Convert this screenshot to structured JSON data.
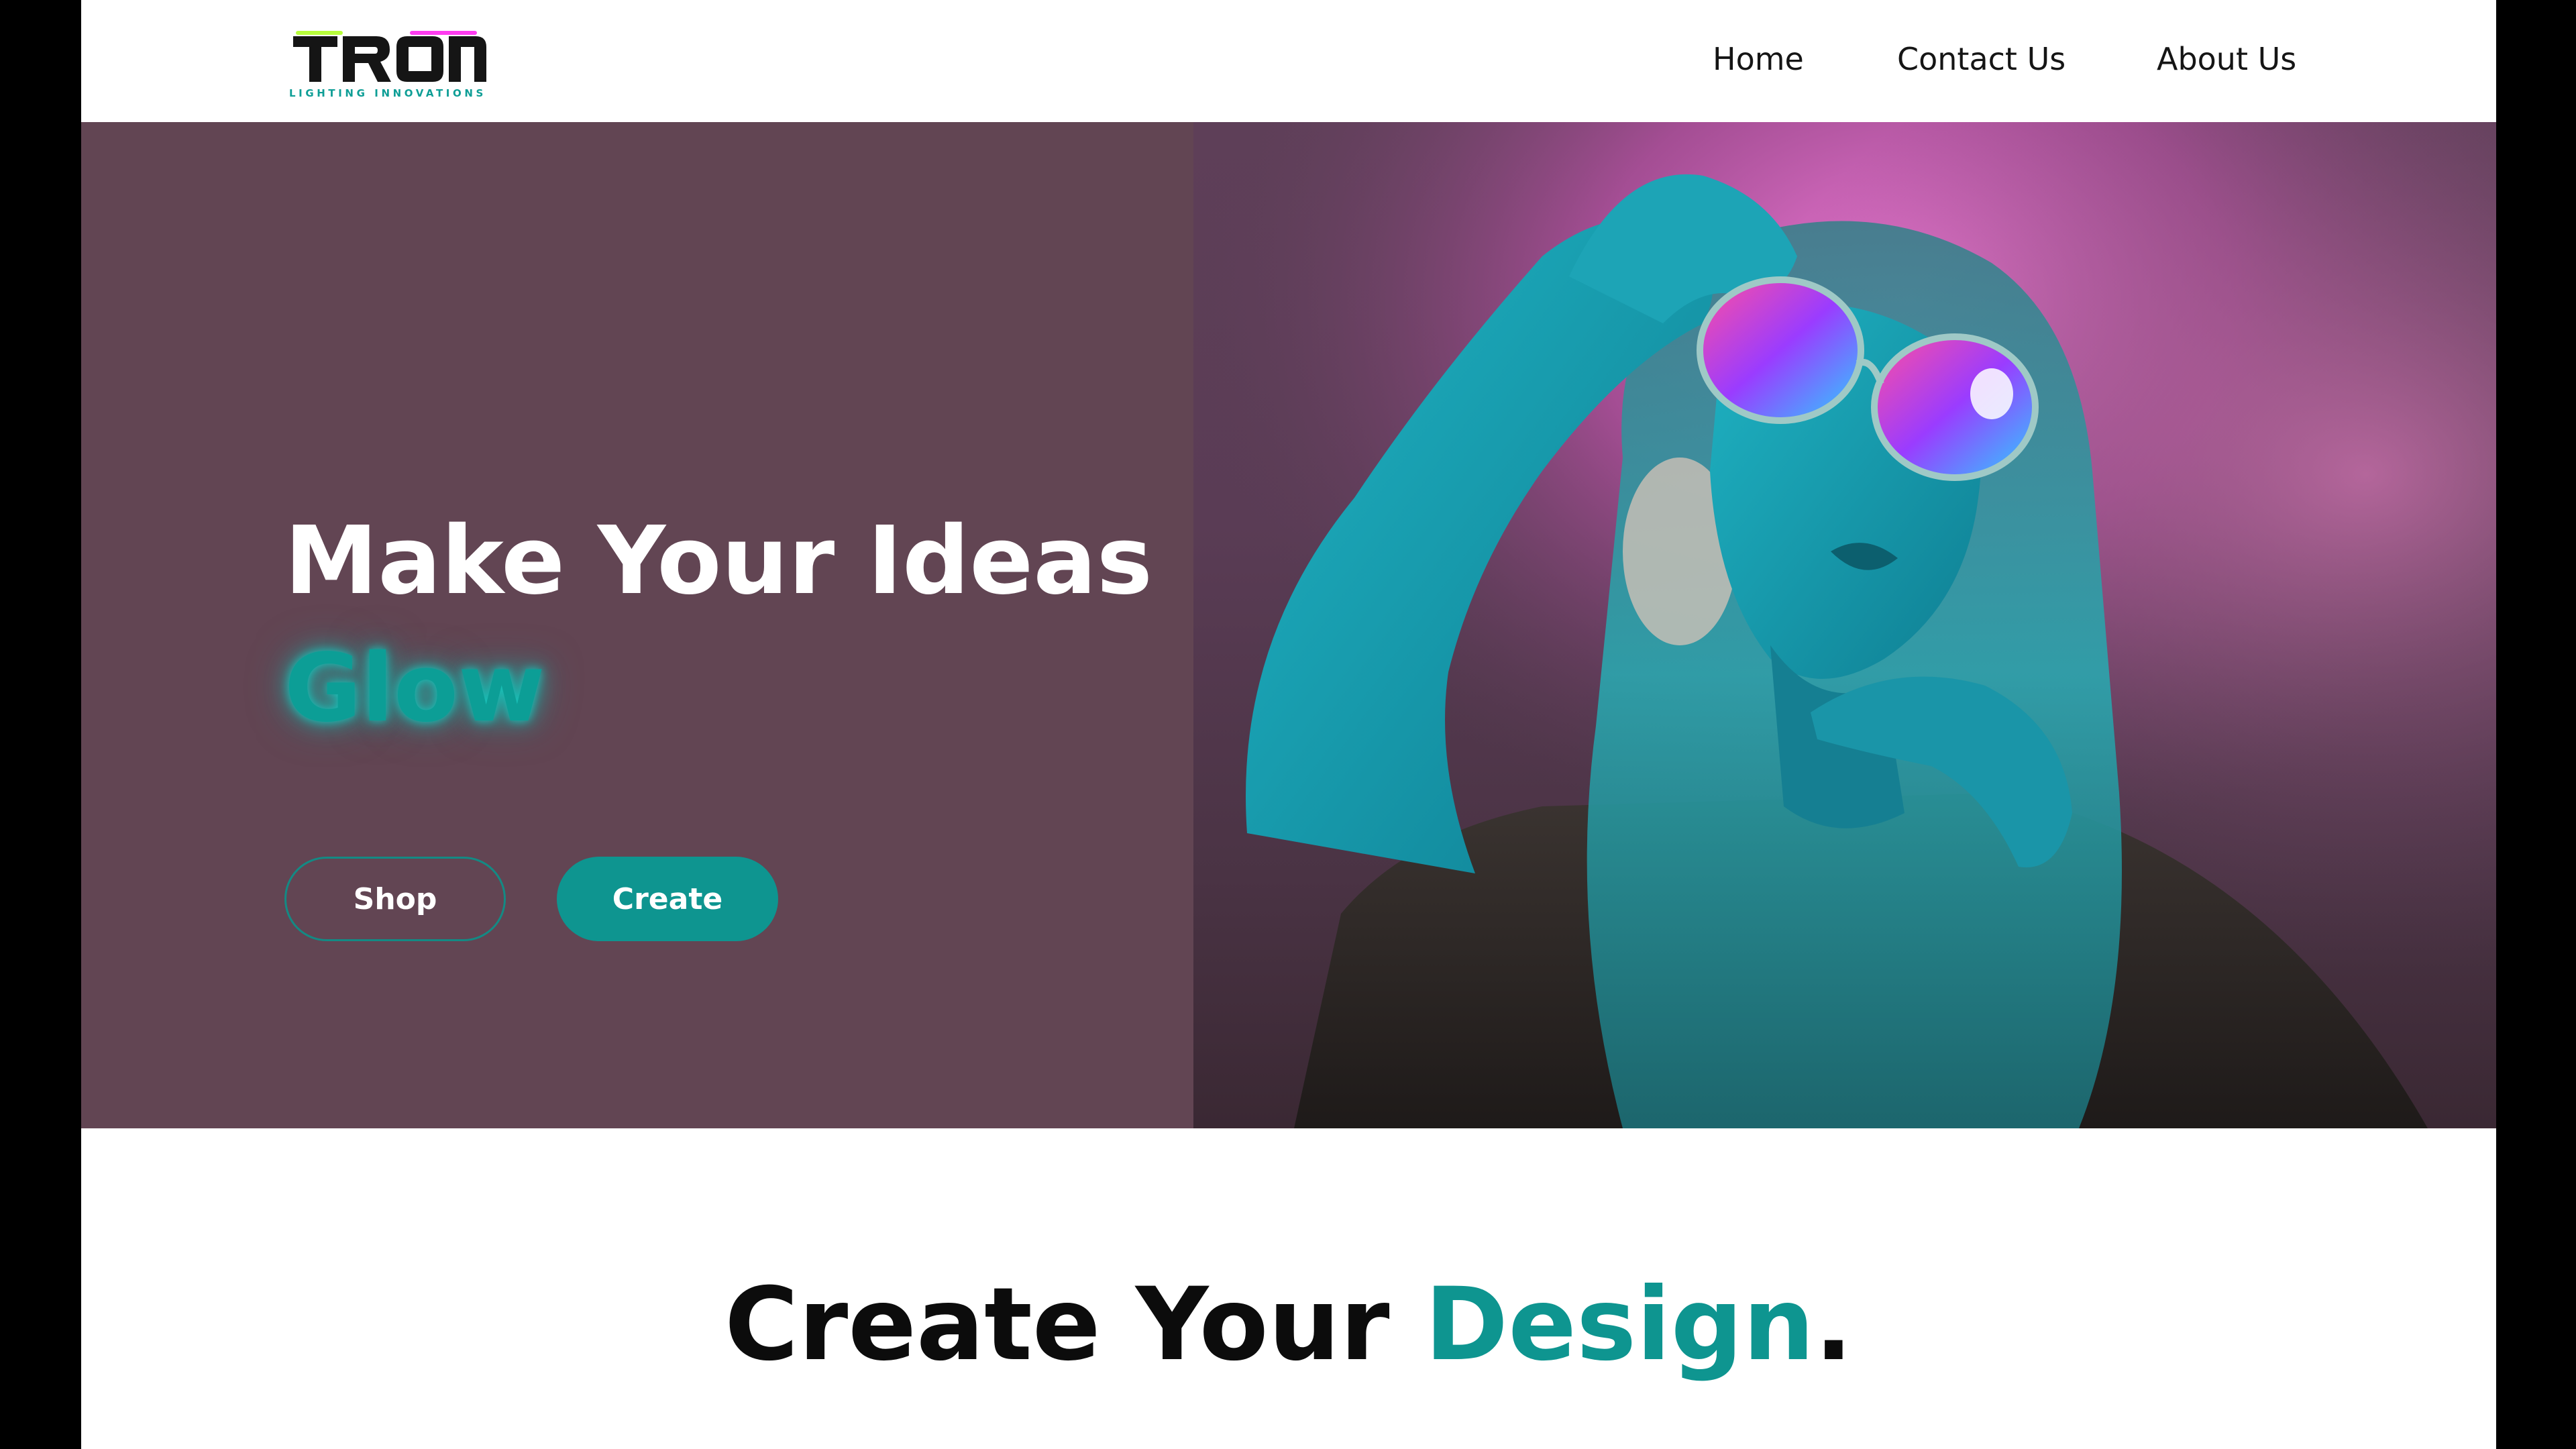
{
  "brand": {
    "name": "TRON",
    "tagline": "LIGHTING INNOVATIONS"
  },
  "nav": {
    "items": [
      {
        "label": "Home"
      },
      {
        "label": "Contact Us"
      },
      {
        "label": "About Us"
      }
    ]
  },
  "hero": {
    "title": "Make Your Ideas",
    "highlight": "Glow",
    "buttons": {
      "shop_label": "Shop",
      "create_label": "Create"
    },
    "image_alt": "woman-with-neon-sunglasses-photo"
  },
  "design_section": {
    "title_prefix": "Create Your ",
    "title_highlight": "Design",
    "title_suffix": "."
  },
  "colors": {
    "accent": "#0e9590",
    "hero_bg": "#624553",
    "text_dark": "#151515"
  }
}
